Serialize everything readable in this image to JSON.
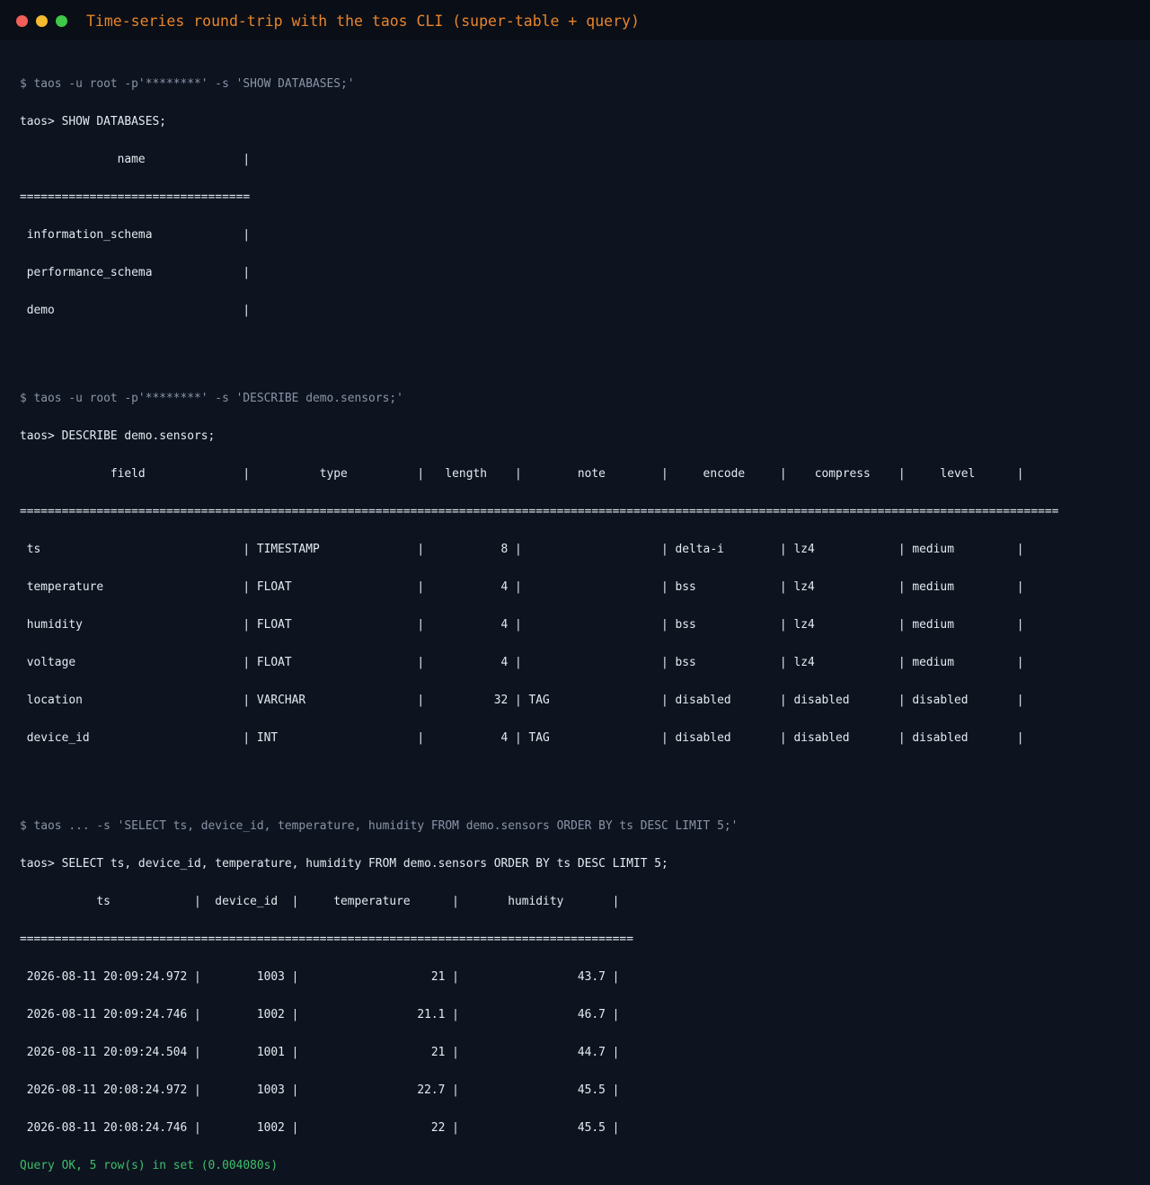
{
  "window": {
    "title": "Time-series round-trip with the taos CLI (super-table + query)"
  },
  "terminal": {
    "block1": {
      "command": "$ taos -u root -p'********' -s 'SHOW DATABASES;'",
      "prompt": "taos> SHOW DATABASES;",
      "header": "              name              |",
      "separator": "=================================",
      "rows": [
        " information_schema             |",
        " performance_schema             |",
        " demo                           |"
      ]
    },
    "block2": {
      "command": "$ taos -u root -p'********' -s 'DESCRIBE demo.sensors;'",
      "prompt": "taos> DESCRIBE demo.sensors;",
      "header": "             field              |          type          |   length    |        note        |     encode     |    compress    |     level      |",
      "separator": "=====================================================================================================================================================",
      "rows": [
        " ts                             | TIMESTAMP              |           8 |                    | delta-i        | lz4            | medium         |",
        " temperature                    | FLOAT                  |           4 |                    | bss            | lz4            | medium         |",
        " humidity                       | FLOAT                  |           4 |                    | bss            | lz4            | medium         |",
        " voltage                        | FLOAT                  |           4 |                    | bss            | lz4            | medium         |",
        " location                       | VARCHAR                |          32 | TAG                | disabled       | disabled       | disabled       |",
        " device_id                      | INT                    |           4 | TAG                | disabled       | disabled       | disabled       |"
      ]
    },
    "block3": {
      "command": "$ taos ... -s 'SELECT ts, device_id, temperature, humidity FROM demo.sensors ORDER BY ts DESC LIMIT 5;'",
      "prompt": "taos> SELECT ts, device_id, temperature, humidity FROM demo.sensors ORDER BY ts DESC LIMIT 5;",
      "header": "           ts            |  device_id  |     temperature      |       humidity       |",
      "separator": "========================================================================================",
      "rows": [
        " 2026-08-11 20:09:24.972 |        1003 |                   21 |                 43.7 |",
        " 2026-08-11 20:09:24.746 |        1002 |                 21.1 |                 46.7 |",
        " 2026-08-11 20:09:24.504 |        1001 |                   21 |                 44.7 |",
        " 2026-08-11 20:08:24.972 |        1003 |                 22.7 |                 45.5 |",
        " 2026-08-11 20:08:24.746 |        1002 |                   22 |                 45.5 |"
      ],
      "status": "Query OK, 5 row(s) in set (0.004080s)"
    }
  },
  "colors": {
    "background": "#0d1420",
    "titlebar": "#0a0e17",
    "title": "#e8852a",
    "command": "#8a94a6",
    "text": "#e6eaf0",
    "ok": "#3fbf6a"
  }
}
